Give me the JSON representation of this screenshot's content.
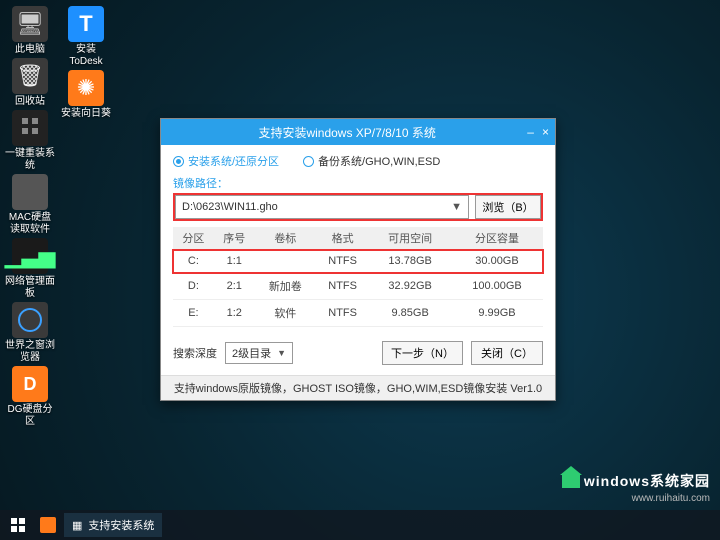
{
  "desktop": {
    "col1": [
      {
        "name": "this-pc",
        "label": "此电脑"
      },
      {
        "name": "recycle-bin",
        "label": "回收站"
      },
      {
        "name": "onekey-reinstall",
        "label": "一键重装系统"
      },
      {
        "name": "mac-disk-reader",
        "label": "MAC硬盘读取软件"
      },
      {
        "name": "network-panel",
        "label": "网络管理面板"
      },
      {
        "name": "world-window-browser",
        "label": "世界之窗浏览器"
      },
      {
        "name": "dg-partition",
        "label": "DG硬盘分区"
      }
    ],
    "col2": [
      {
        "name": "install-todesk",
        "label": "安装ToDesk"
      },
      {
        "name": "install-sunflower",
        "label": "安装向日葵"
      }
    ]
  },
  "dialog": {
    "title": "支持安装windows XP/7/8/10 系统",
    "minimize": "–",
    "close": "×",
    "radio_install": "安装系统/还原分区",
    "radio_backup": "备份系统/GHO,WIN,ESD",
    "path_label": "镜像路径：",
    "path_value": "D:\\0623\\WIN11.gho",
    "browse": "浏览（B）",
    "columns": {
      "c0": "分区",
      "c1": "序号",
      "c2": "卷标",
      "c3": "格式",
      "c4": "可用空间",
      "c5": "分区容量"
    },
    "rows": [
      {
        "part": "C:",
        "idx": "1:1",
        "vol": "",
        "fs": "NTFS",
        "free": "13.78GB",
        "cap": "30.00GB"
      },
      {
        "part": "D:",
        "idx": "2:1",
        "vol": "新加卷",
        "fs": "NTFS",
        "free": "32.92GB",
        "cap": "100.00GB"
      },
      {
        "part": "E:",
        "idx": "1:2",
        "vol": "软件",
        "fs": "NTFS",
        "free": "9.85GB",
        "cap": "9.99GB"
      }
    ],
    "search_depth_label": "搜索深度",
    "search_depth_value": "2级目录",
    "next": "下一步（N）",
    "close_btn": "关闭（C）",
    "support_bar": "支持windows原版镜像，GHOST ISO镜像，GHO,WIM,ESD镜像安装 Ver1.0"
  },
  "taskbar": {
    "app": "支持安装系统"
  },
  "watermark": {
    "brand": "windows系统家园",
    "url": "www.ruihaitu.com"
  }
}
